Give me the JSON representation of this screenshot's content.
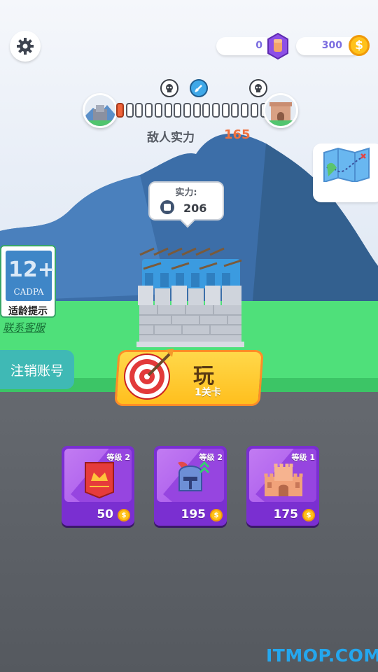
{
  "currency": {
    "gems": "0",
    "coins": "300"
  },
  "progress": {
    "segments_total": 16,
    "segments_filled": 1
  },
  "enemy": {
    "label": "敌人实力",
    "value": "165"
  },
  "power": {
    "label": "实力:",
    "value": "206"
  },
  "age_rating": {
    "number": "12+",
    "org": "CADPA",
    "label": "适龄提示"
  },
  "links": {
    "contact_service": "联系客服",
    "cancel_account": "注销账号"
  },
  "play": {
    "label": "玩",
    "level": "1关卡"
  },
  "upgrades": [
    {
      "name": "banner",
      "level": "等级 2",
      "price": "50"
    },
    {
      "name": "helmet",
      "level": "等级 2",
      "price": "195"
    },
    {
      "name": "castle",
      "level": "等级 1",
      "price": "175"
    }
  ],
  "watermark": "ITMOP.COM",
  "colors": {
    "grass": "#4fe07a",
    "accent_orange": "#ff8d27",
    "card_purple": "#7a2fd1",
    "enemy_value": "#f0713e"
  }
}
